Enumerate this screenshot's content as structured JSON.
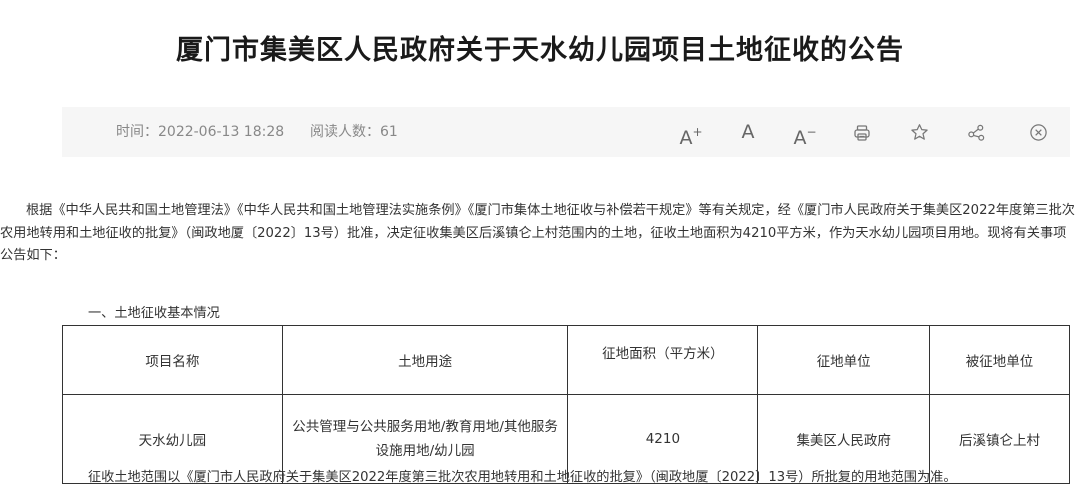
{
  "title": "厦门市集美区人民政府关于天水幼儿园项目土地征收的公告",
  "meta": {
    "time": "时间：2022-06-13 18:28",
    "reads": "阅读人数：61"
  },
  "toolbar": {
    "font_increase": "A",
    "font_increase_sup": "+",
    "font_normal": "A",
    "font_decrease": "A",
    "font_decrease_sup": "−",
    "icons": [
      "print-icon",
      "star-icon",
      "share-icon",
      "close-icon"
    ]
  },
  "body": {
    "paragraph1": "根据《中华人民共和国土地管理法》《中华人民共和国土地管理法实施条例》《厦门市集体土地征收与补偿若干规定》等有关规定，经《厦门市人民政府关于集美区2022年度第三批次农用地转用和土地征收的批复》（闽政地厦〔2022〕13号）批准，决定征收集美区后溪镇仑上村范围内的土地，征收土地面积为4210平方米，作为天水幼儿园项目用地。现将有关事项公告如下：",
    "section1": "一、土地征收基本情况",
    "footer": "征收土地范围以《厦门市人民政府关于集美区2022年度第三批次农用地转用和土地征收的批复》（闽政地厦〔2022〕13号）所批复的用地范围为准。"
  },
  "table": {
    "headers": [
      "项目名称",
      "土地用途",
      "征地面积（平方米）",
      "征地单位",
      "被征地单位"
    ],
    "rows": [
      [
        "天水幼儿园",
        "公共管理与公共服务用地/教育用地/其他服务设施用地/幼儿园",
        "4210",
        "集美区人民政府",
        "后溪镇仑上村"
      ]
    ]
  }
}
